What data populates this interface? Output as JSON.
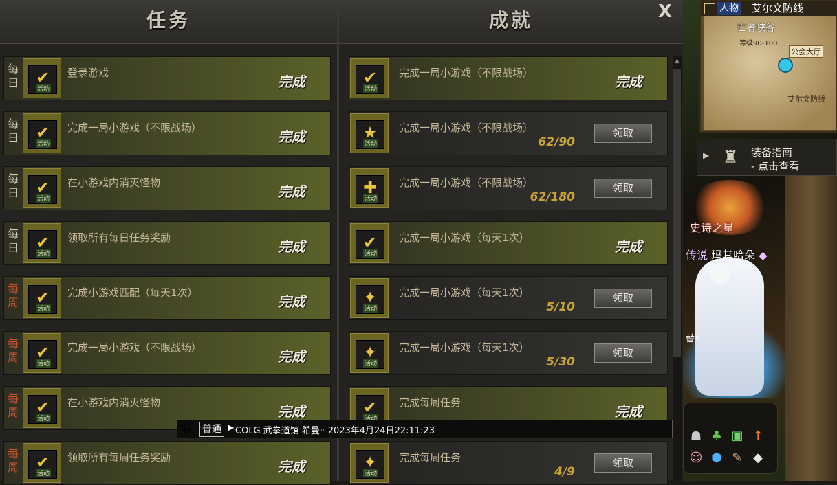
{
  "quest_panel": {
    "title": "任务",
    "tag": "活动",
    "rows": [
      {
        "freq": "每日",
        "kind": "daily",
        "title": "登录游戏",
        "status": "完成",
        "icon_name": "login-icon",
        "glyph": "✔",
        "state": "done"
      },
      {
        "freq": "每日",
        "kind": "daily",
        "title": "完成一局小游戏（不限战场）",
        "status": "完成",
        "icon_name": "minigame-icon",
        "glyph": "✔",
        "state": "done"
      },
      {
        "freq": "每日",
        "kind": "daily",
        "title": "在小游戏内消灭怪物",
        "status": "完成",
        "icon_name": "monster-icon",
        "glyph": "✔",
        "state": "done"
      },
      {
        "freq": "每日",
        "kind": "daily",
        "title": "领取所有每日任务奖励",
        "status": "完成",
        "icon_name": "reward-icon",
        "glyph": "✔",
        "state": "done"
      },
      {
        "freq": "每周",
        "kind": "weekly",
        "title": "完成小游戏匹配（每天1次）",
        "status": "完成",
        "icon_name": "match-icon",
        "glyph": "✔",
        "state": "done"
      },
      {
        "freq": "每周",
        "kind": "weekly",
        "title": "完成一局小游戏（不限战场）",
        "status": "完成",
        "icon_name": "minigame-icon",
        "glyph": "✔",
        "state": "done"
      },
      {
        "freq": "每周",
        "kind": "weekly",
        "title": "在小游戏内消灭怪物",
        "status": "完成",
        "icon_name": "monster-icon",
        "glyph": "✔",
        "state": "done"
      },
      {
        "freq": "每周",
        "kind": "weekly",
        "title": "领取所有每周任务奖励",
        "status": "完成",
        "icon_name": "reward-icon",
        "glyph": "✔",
        "state": "done"
      }
    ]
  },
  "achievement_panel": {
    "title": "成就",
    "close_label": "X",
    "claim_label": "领取",
    "rows": [
      {
        "title": "完成一局小游戏（不限战场）",
        "status": "完成",
        "progress": "",
        "state": "done",
        "icon_name": "minigame-icon",
        "glyph": "✔"
      },
      {
        "title": "完成一局小游戏（不限战场）",
        "status": "",
        "progress": "62/90",
        "state": "todo",
        "icon_name": "gold-chest-icon",
        "glyph": "★"
      },
      {
        "title": "完成一局小游戏（不限战场）",
        "status": "",
        "progress": "62/180",
        "state": "todo",
        "icon_name": "gift-box-icon",
        "glyph": "✚"
      },
      {
        "title": "完成一局小游戏（每天1次）",
        "status": "完成",
        "progress": "",
        "state": "done",
        "icon_name": "sword-icon",
        "glyph": "✔"
      },
      {
        "title": "完成一局小游戏（每天1次）",
        "status": "",
        "progress": "5/10",
        "state": "todo",
        "icon_name": "sword-icon",
        "glyph": "✦"
      },
      {
        "title": "完成一局小游戏（每天1次）",
        "status": "",
        "progress": "5/30",
        "state": "todo",
        "icon_name": "ice-sword-icon",
        "glyph": "✦"
      },
      {
        "title": "完成每周任务",
        "status": "完成",
        "progress": "",
        "state": "done",
        "icon_name": "weekly-task-icon",
        "glyph": "✔"
      },
      {
        "title": "完成每周任务",
        "status": "",
        "progress": "4/9",
        "state": "todo",
        "icon_name": "weekly-task-icon",
        "glyph": "✦"
      }
    ]
  },
  "chat": {
    "channel": "普通",
    "message": "COLG 武拳道馆 希曼◦ 2023年4月24日22:11:23"
  },
  "minimap": {
    "tab": "人物",
    "area": "艾尔文防线",
    "zone": "亡者峡谷",
    "level": "等级90-100",
    "hall": "公会大厅",
    "place": "艾尔文防线"
  },
  "guide": {
    "title": "装备指南",
    "subtitle": "- 点击查看"
  },
  "character": {
    "emblem_text": "史诗之星",
    "legend_prefix": "传说",
    "legend_name": "玛其哈朵",
    "pet_name": "替Y"
  },
  "dock_icons": [
    "ghost-icon",
    "sprout-icon",
    "scroll-icon",
    "upgrade-arrow-icon",
    "avatar-icon",
    "tp-icon",
    "book-icon",
    "diamond-icon"
  ],
  "colors": {
    "done_row": "#5a6128",
    "weekly_text": "#c5532f",
    "progress_gold": "#c9a43a",
    "icon_frame": "#6c6521"
  }
}
